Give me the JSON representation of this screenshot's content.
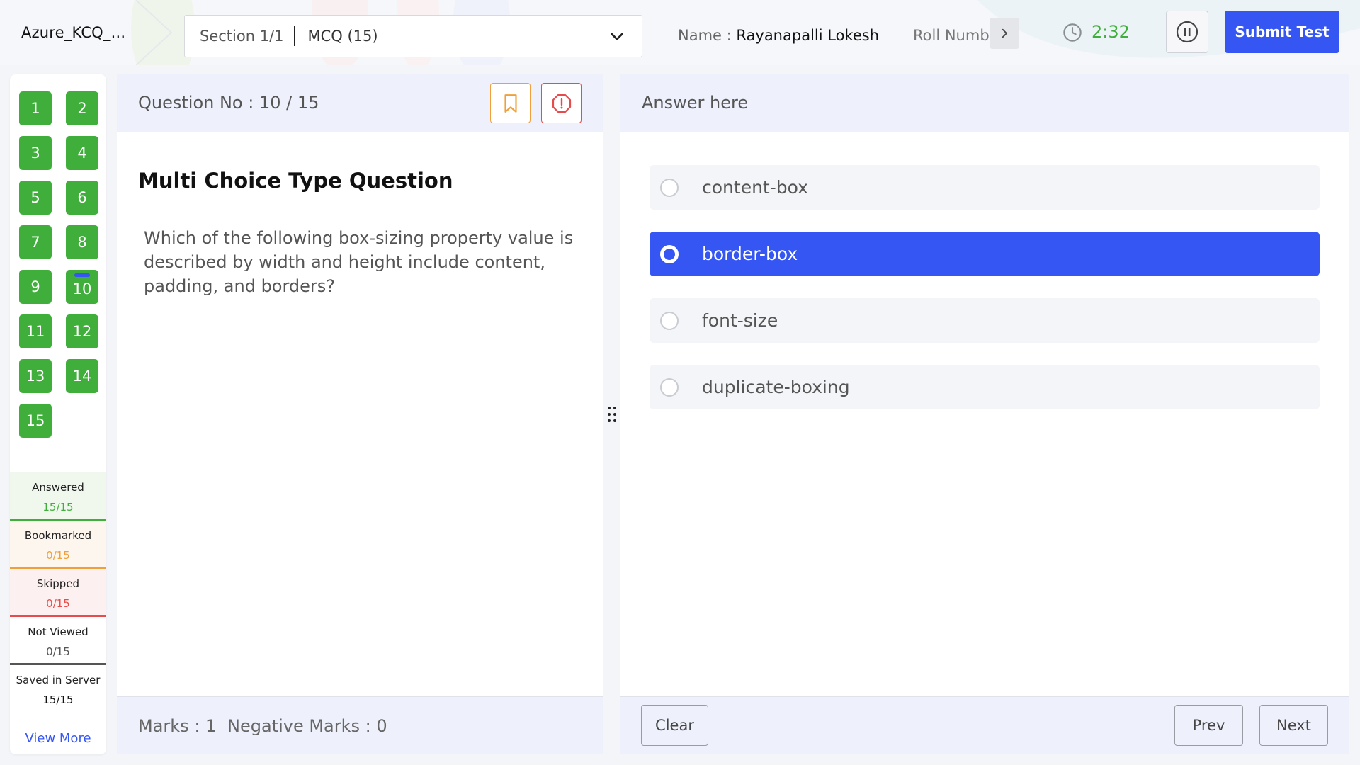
{
  "header": {
    "app_title": "Azure_KCQ_...",
    "section_label": "Section 1/1",
    "section_type": "MCQ (15)",
    "name_prefix": "Name : ",
    "name_value": "Rayanapalli Lokesh",
    "roll_label": "Roll Numb",
    "timer": "2:32",
    "submit_label": "Submit Test"
  },
  "sidebar": {
    "questions": [
      "1",
      "2",
      "3",
      "4",
      "5",
      "6",
      "7",
      "8",
      "9",
      "10",
      "11",
      "12",
      "13",
      "14",
      "15"
    ],
    "current_question": "10",
    "stats": [
      {
        "label": "Answered",
        "value": "15/15",
        "color": "#3fae3a"
      },
      {
        "label": "Bookmarked",
        "value": "0/15",
        "color": "#f0a03a"
      },
      {
        "label": "Skipped",
        "value": "0/15",
        "color": "#e84b4b"
      },
      {
        "label": "Not Viewed",
        "value": "0/15",
        "color": "#555555"
      },
      {
        "label": "Saved in Server",
        "value": "15/15",
        "color": "#111111"
      }
    ],
    "view_more": "View More"
  },
  "question": {
    "number_label": "Question No : 10 / 15",
    "type_title": "Multi Choice Type Question",
    "text": "Which of the following box-sizing property value is described by width and height include content, padding, and borders?",
    "marks": "Marks : 1",
    "negative_marks": "Negative Marks : 0"
  },
  "answer": {
    "title": "Answer here",
    "options": [
      "content-box",
      "border-box",
      "font-size",
      "duplicate-boxing"
    ],
    "selected_index": 1,
    "clear_label": "Clear",
    "prev_label": "Prev",
    "next_label": "Next"
  },
  "colors": {
    "accent": "#3556f2",
    "success": "#3fae3a",
    "warning": "#f0a03a",
    "danger": "#e84b4b"
  }
}
